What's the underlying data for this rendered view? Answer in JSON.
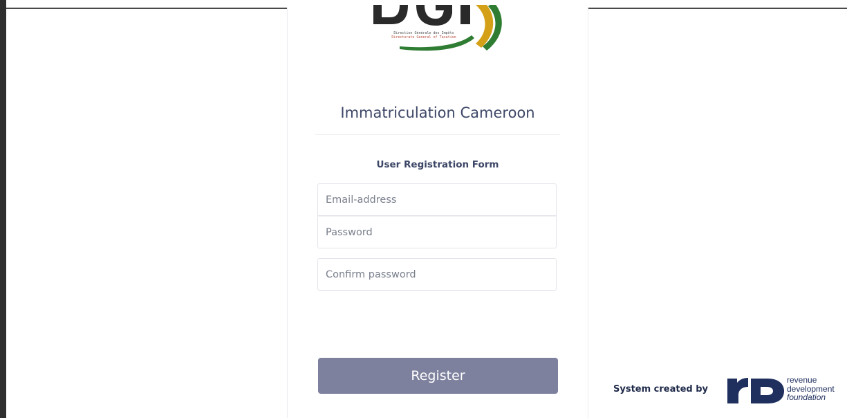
{
  "logo": {
    "letters": "DGI",
    "caption_line1": "Direction Générale des Impôts",
    "caption_line2": "Directorate General of Taxation",
    "colors": {
      "letters": "#2a2a2a",
      "green": "#2f7d32",
      "gold": "#d4a017"
    }
  },
  "page": {
    "title": "Immatriculation Cameroon",
    "subtitle": "User Registration Form"
  },
  "form": {
    "email_placeholder": "Email-address",
    "password_placeholder": "Password",
    "confirm_placeholder": "Confirm password",
    "register_label": "Register"
  },
  "footer": {
    "credit_text": "System created by",
    "partner_logo_text": [
      "revenue",
      "development",
      "foundation"
    ],
    "partner_logo_mark": "rD"
  },
  "colors": {
    "title": "#3c4666",
    "button": "#7d819d",
    "partner_brand": "#1f2f5e"
  }
}
